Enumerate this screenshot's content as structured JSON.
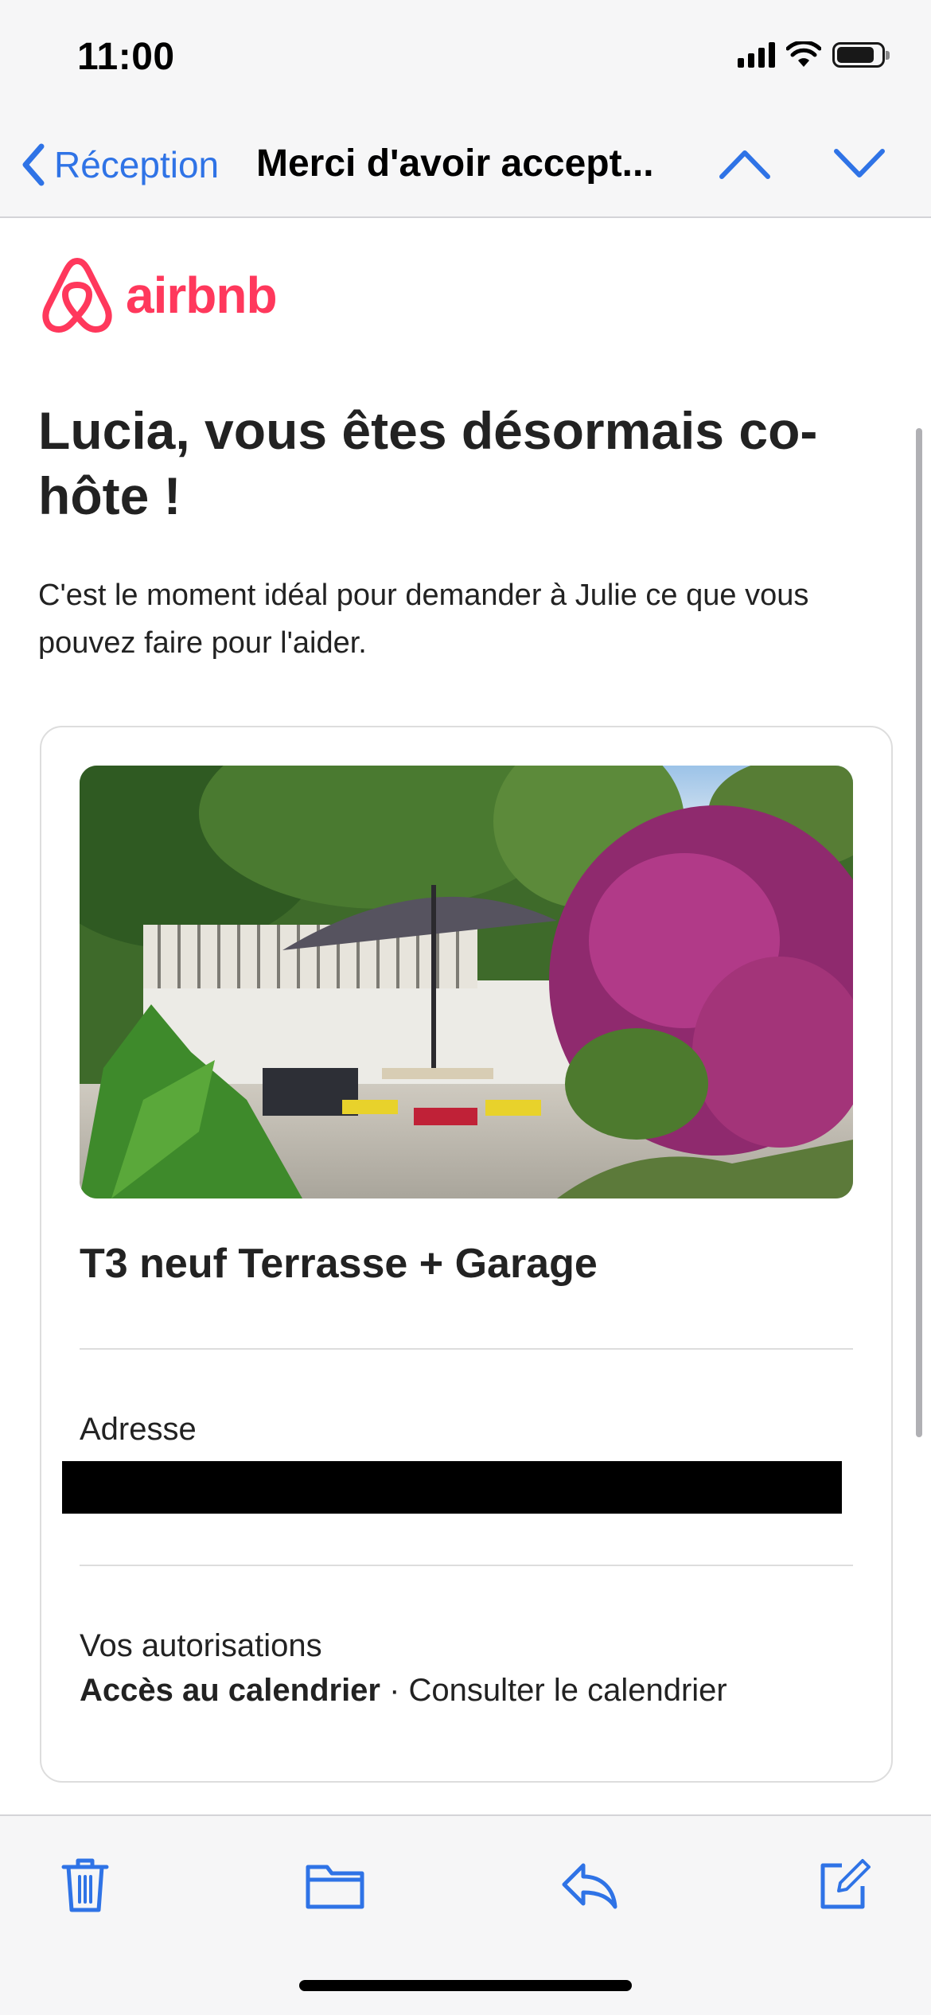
{
  "status_bar": {
    "time": "11:00"
  },
  "nav": {
    "back_label": "Réception",
    "subject": "Merci d'avoir accept..."
  },
  "email": {
    "brand": "airbnb",
    "brand_color": "#ff385c",
    "headline": "Lucia, vous êtes désormais co-hôte !",
    "intro": "C'est le moment idéal pour demander à Julie ce que vous pouvez faire pour l'aider.",
    "card": {
      "listing_title": "T3 neuf Terrasse + Garage",
      "address_label": "Adresse",
      "permissions_label": "Vos autorisations",
      "permission_name": "Accès au calendrier",
      "permission_separator": " · ",
      "permission_detail": "Consulter le calendrier"
    }
  },
  "toolbar": {
    "icons": [
      "trash-icon",
      "folder-icon",
      "reply-icon",
      "compose-icon"
    ]
  },
  "colors": {
    "accent": "#2f73e6",
    "text": "#222222",
    "bar_bg": "#f6f6f7"
  }
}
